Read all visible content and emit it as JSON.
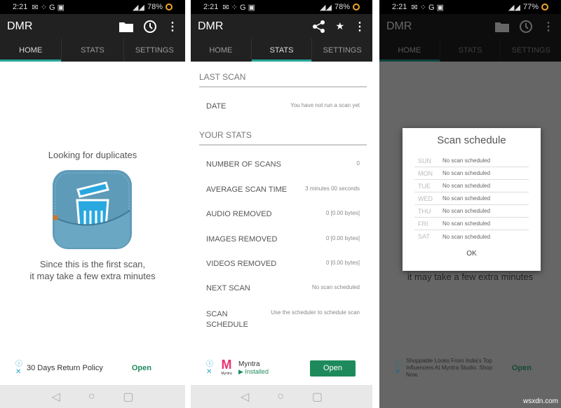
{
  "status": {
    "time": "2:21",
    "battery": [
      "78%",
      "78%",
      "77%"
    ]
  },
  "app": {
    "title": "DMR"
  },
  "tabs": [
    "HOME",
    "STATS",
    "SETTINGS"
  ],
  "home": {
    "heading": "Looking for duplicates",
    "line1": "Since this is the first scan,",
    "line2": "it may take a few extra minutes",
    "ad_text": "30 Days Return Policy",
    "ad_button": "Open"
  },
  "stats": {
    "last_scan_header": "LAST SCAN",
    "your_stats_header": "YOUR STATS",
    "date": {
      "label": "DATE",
      "value": "You have not run a scan yet"
    },
    "rows": [
      {
        "label": "NUMBER OF SCANS",
        "value": "0"
      },
      {
        "label": "AVERAGE SCAN TIME",
        "value": "3 minutes 00 seconds"
      },
      {
        "label": "AUDIO REMOVED",
        "value": "0 [0.00 bytes]"
      },
      {
        "label": "IMAGES REMOVED",
        "value": "0 [0.00 bytes]"
      },
      {
        "label": "VIDEOS REMOVED",
        "value": "0 [0.00 bytes]"
      },
      {
        "label": "NEXT SCAN",
        "value": "No scan scheduled"
      }
    ],
    "schedule": {
      "label1": "SCAN",
      "label2": "SCHEDULE",
      "value": "Use the scheduler to schedule scan"
    },
    "ad": {
      "name": "Myntra",
      "logo_text": "Myntra",
      "status": "Installed",
      "button": "Open",
      "button_color": "#1e8a5c"
    }
  },
  "dialog": {
    "title": "Scan schedule",
    "days": [
      {
        "day": "SUN",
        "status": "No scan scheduled"
      },
      {
        "day": "MON",
        "status": "No scan scheduled"
      },
      {
        "day": "TUE",
        "status": "No scan scheduled"
      },
      {
        "day": "WED",
        "status": "No scan scheduled"
      },
      {
        "day": "THU",
        "status": "No scan scheduled"
      },
      {
        "day": "FRI",
        "status": "No scan scheduled"
      },
      {
        "day": "SAT",
        "status": "No scan scheduled"
      }
    ],
    "ok": "OK",
    "ad_text": "Shoppable Looks From India's Top Influencers At Myntra Studio. Shop Now.",
    "ad_button": "Open"
  },
  "watermark": "wsxdn.com",
  "colors": {
    "accent": "#26a69a",
    "appbar": "#212121",
    "ad_green": "#1e8a5c"
  }
}
